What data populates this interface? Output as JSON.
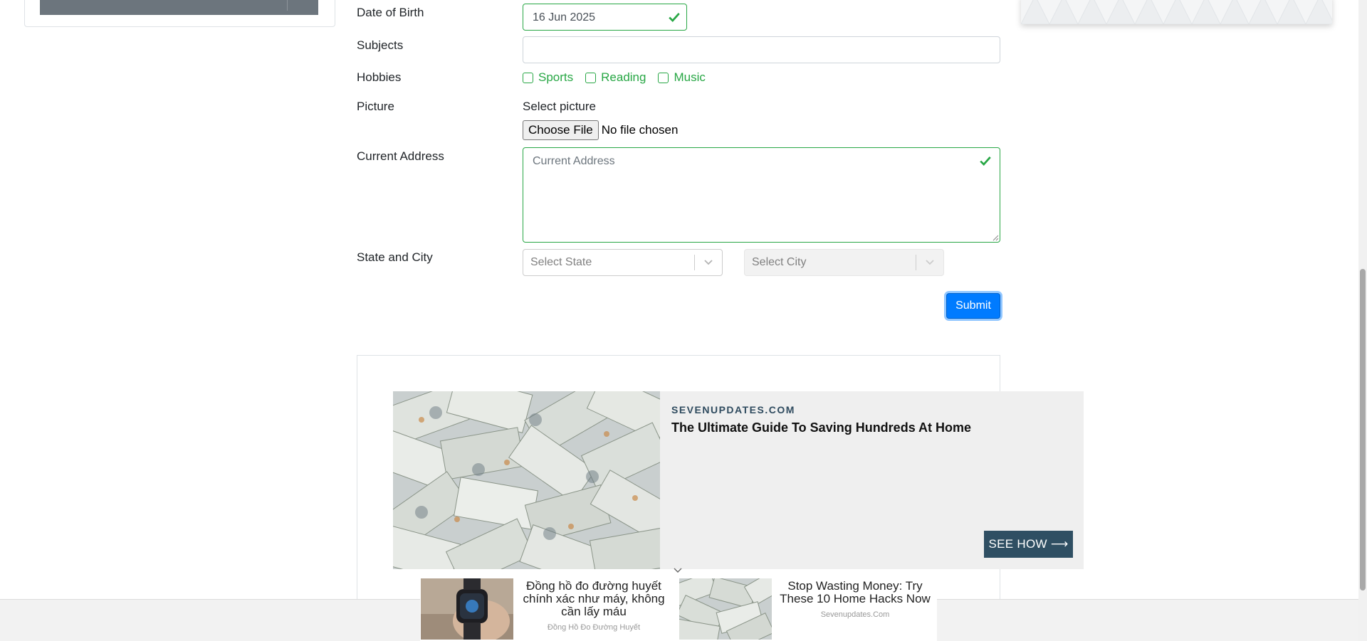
{
  "form": {
    "dob": {
      "label": "Date of Birth",
      "value": "16 Jun 2025"
    },
    "subjects": {
      "label": "Subjects",
      "value": ""
    },
    "hobbies": {
      "label": "Hobbies",
      "options": [
        "Sports",
        "Reading",
        "Music"
      ]
    },
    "picture": {
      "label": "Picture",
      "caption": "Select picture",
      "button": "Choose File",
      "status": "No file chosen"
    },
    "address": {
      "label": "Current Address",
      "placeholder": "Current Address"
    },
    "state_city": {
      "label": "State and City",
      "state_placeholder": "Select State",
      "city_placeholder": "Select City"
    },
    "submit_label": "Submit"
  },
  "ad_main": {
    "domain": "SEVENUPDATES.COM",
    "headline": "The Ultimate Guide To Saving Hundreds At Home",
    "cta": "SEE HOW ⟶"
  },
  "bottom_ads": [
    {
      "title": "Đồng hồ đo đường huyết chính xác như máy, không cần lấy máu",
      "source": "Đồng Hồ Đo Đường Huyết"
    },
    {
      "title": "Stop Wasting Money: Try These 10 Home Hacks Now",
      "source": "Sevenupdates.Com"
    }
  ],
  "colors": {
    "valid": "#28a745",
    "primary": "#007bff",
    "cta_bg": "#2f4f63"
  }
}
